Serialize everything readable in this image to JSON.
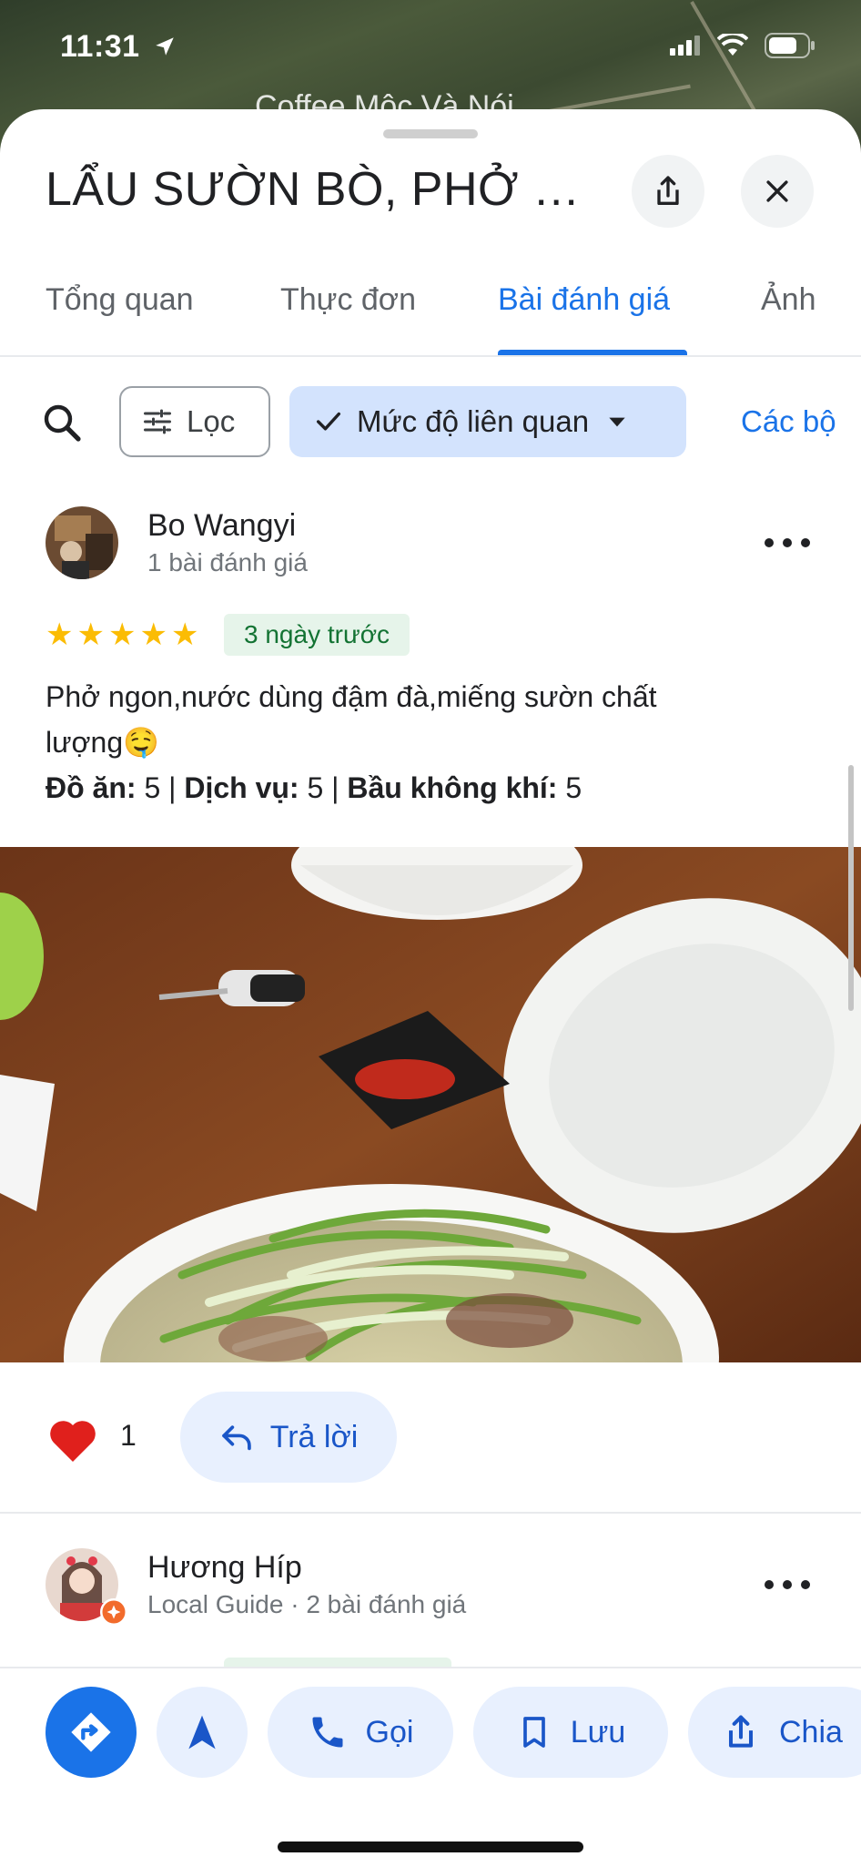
{
  "status_bar": {
    "time": "11:31"
  },
  "map": {
    "label": "Coffee Mộc Và Nói"
  },
  "place": {
    "title": "LẨU SƯỜN BÒ, PHỞ S..."
  },
  "tabs": [
    {
      "label": "Tổng quan"
    },
    {
      "label": "Thực đơn"
    },
    {
      "label": "Bài đánh giá",
      "active": true
    },
    {
      "label": "Ảnh"
    }
  ],
  "filters": {
    "filter_label": "Lọc",
    "sort_label": "Mức độ liên quan",
    "more_label": "Các bộ"
  },
  "reviews": [
    {
      "name": "Bo Wangyi",
      "meta": "1 bài đánh giá",
      "rating": 5,
      "date": "3 ngày trước",
      "text_line1": "Phở ngon,nước dùng đậm đà,miếng sườn chất",
      "text_line2": "lượng🤤",
      "ratings": {
        "food_label": "Đồ ăn:",
        "food": "5",
        "service_label": "Dịch vụ:",
        "service": "5",
        "atmosphere_label": "Bầu không khí:",
        "atmosphere": "5"
      },
      "likes": "1",
      "reply_label": "Trả lời"
    },
    {
      "name": "Hương Híp",
      "meta": "Local Guide · 2 bài đánh giá"
    }
  ],
  "bottom_actions": {
    "call": "Gọi",
    "save": "Lưu",
    "share": "Chia"
  },
  "colors": {
    "accent": "#1a73e8",
    "chip_bg": "#d3e3fd",
    "button_bg": "#e8f0fe",
    "star": "#fbbc04",
    "date_badge_bg": "#e6f4ea",
    "date_badge_text": "#137333"
  }
}
